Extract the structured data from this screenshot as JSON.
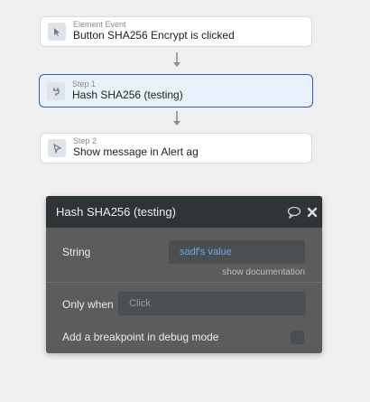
{
  "workflow": {
    "cards": [
      {
        "sub": "Element Event",
        "main": "Button SHA256 Encrypt is clicked",
        "icon": "cursor-icon"
      },
      {
        "sub": "Step 1",
        "main": "Hash SHA256 (testing)",
        "icon": "plug-icon"
      },
      {
        "sub": "Step 2",
        "main": "Show message in Alert ag",
        "icon": "pointer-icon"
      }
    ]
  },
  "panel": {
    "title": "Hash SHA256 (testing)",
    "string_label": "String",
    "string_value": "sadf's value",
    "show_documentation": "show documentation",
    "only_when_label": "Only when",
    "only_when_placeholder": "Click",
    "breakpoint_label": "Add a breakpoint in debug mode"
  },
  "colors": {
    "accent": "#2f5fa8",
    "value_link": "#6fa8e6"
  }
}
